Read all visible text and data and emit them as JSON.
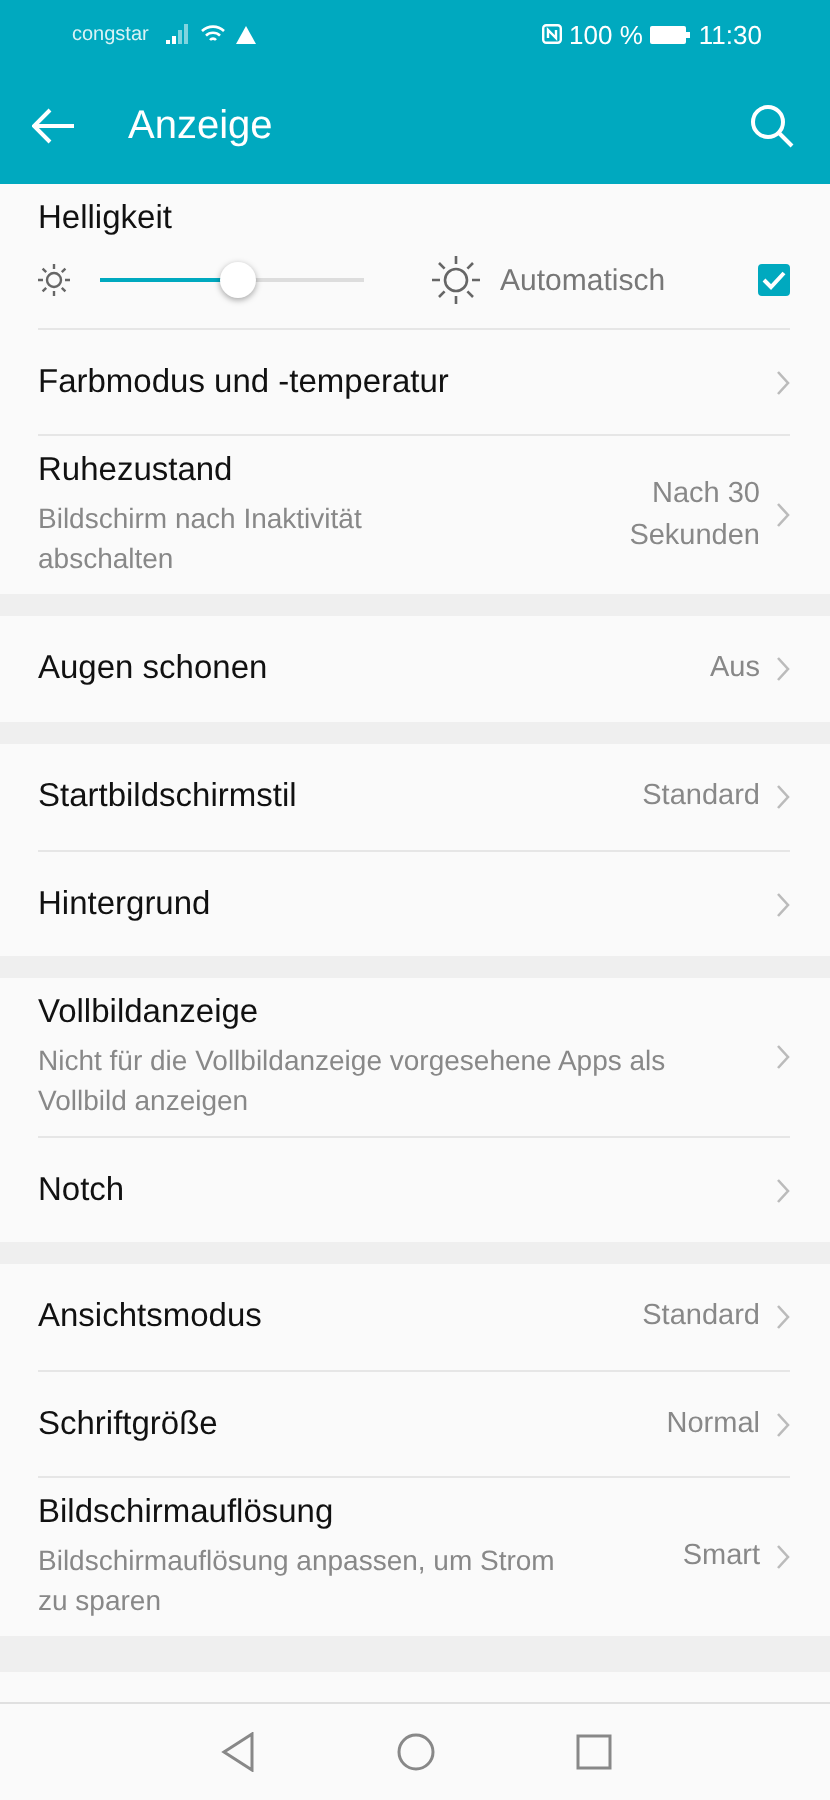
{
  "status_bar": {
    "carrier": "congstar",
    "battery_text": "100 %",
    "time": "11:30"
  },
  "app_bar": {
    "title": "Anzeige"
  },
  "brightness": {
    "label": "Helligkeit",
    "level": 0.52,
    "auto_label": "Automatisch",
    "auto_checked": true
  },
  "sections": [
    [
      {
        "title": "Farbmodus und -temperatur"
      },
      {
        "title": "Ruhezustand",
        "subtitle": "Bildschirm nach Inaktivität abschalten",
        "value": "Nach 30 Sekunden"
      }
    ],
    [
      {
        "title": "Augen schonen",
        "value": "Aus"
      }
    ],
    [
      {
        "title": "Startbildschirmstil",
        "value": "Standard"
      },
      {
        "title": "Hintergrund"
      }
    ],
    [
      {
        "title": "Vollbildanzeige",
        "subtitle": "Nicht für die Vollbildanzeige vorgesehene Apps als Vollbild anzeigen"
      },
      {
        "title": "Notch"
      }
    ],
    [
      {
        "title": "Ansichtsmodus",
        "value": "Standard"
      },
      {
        "title": "Schriftgröße",
        "value": "Normal"
      },
      {
        "title": "Bildschirmauflösung",
        "subtitle": "Bildschirmauflösung anpassen, um Strom zu sparen",
        "value": "Smart"
      }
    ]
  ]
}
